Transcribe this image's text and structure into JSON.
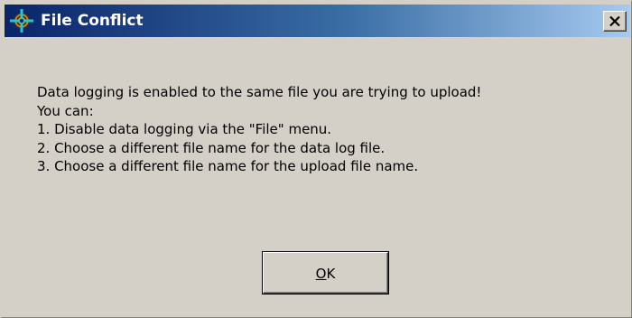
{
  "dialog": {
    "title": "File Conflict",
    "close_symbol": "×",
    "icon": "app-crosshair-icon",
    "message_lines": [
      "Data logging is enabled to the same file you are trying to upload!",
      "You can:",
      "1. Disable data logging via the \"File\" menu.",
      "2. Choose a different file name for the data log file.",
      "3. Choose a different file name for the upload file name."
    ],
    "ok_button": {
      "label": "OK",
      "mnemonic": "O",
      "rest": "K"
    }
  },
  "colors": {
    "titlebar_start": "#0a246a",
    "titlebar_end": "#a6caf0",
    "face": "#d4d0c8"
  }
}
